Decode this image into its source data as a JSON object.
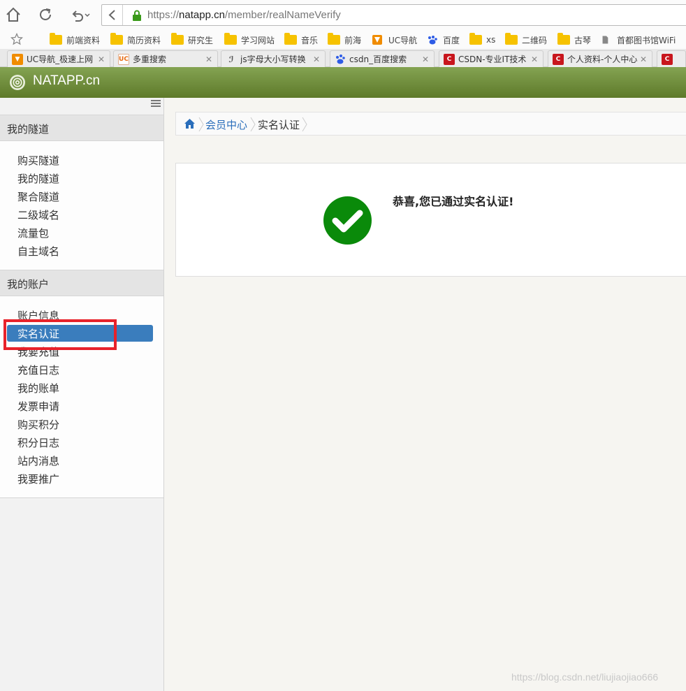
{
  "browser": {
    "url_prefix": "https://",
    "url_domain": "natapp.cn",
    "url_path": "/member/realNameVerify",
    "bookmarks": [
      {
        "label": "前端资料",
        "icon": "folder-icon"
      },
      {
        "label": "简历资料",
        "icon": "folder-icon"
      },
      {
        "label": "研究生",
        "icon": "folder-icon"
      },
      {
        "label": "学习网站",
        "icon": "folder-icon"
      },
      {
        "label": "音乐",
        "icon": "folder-icon"
      },
      {
        "label": "前海",
        "icon": "folder-icon"
      },
      {
        "label": "UC导航",
        "icon": "uc-nav-icon"
      },
      {
        "label": "百度",
        "icon": "baidu-icon"
      },
      {
        "label": "xs",
        "icon": "folder-icon"
      },
      {
        "label": "二维码",
        "icon": "folder-icon"
      },
      {
        "label": "古琴",
        "icon": "folder-icon"
      },
      {
        "label": "首都图书馆WiFi",
        "icon": "page-icon"
      }
    ],
    "tabs": [
      {
        "title": "UC导航_极速上网",
        "icon": "uc-nav-icon"
      },
      {
        "title": "多重搜索",
        "icon": "uc-icon"
      },
      {
        "title": "js字母大小写转换",
        "icon": "js-icon"
      },
      {
        "title": "csdn_百度搜索",
        "icon": "baidu-icon"
      },
      {
        "title": "CSDN-专业IT技术",
        "icon": "csdn-icon"
      },
      {
        "title": "个人资料-个人中心",
        "icon": "csdn-icon"
      },
      {
        "title": "",
        "icon": "csdn-icon"
      }
    ],
    "colors": {
      "csdn": "#c8161d",
      "uc": "#f08c00",
      "baidu": "#2e5ce6"
    }
  },
  "site": {
    "brand": "NATAPP.cn",
    "header_color": "#6e8c3a"
  },
  "sidebar": {
    "section1": {
      "title": "我的隧道",
      "items": [
        "购买隧道",
        "我的隧道",
        "聚合隧道",
        "二级域名",
        "流量包",
        "自主域名"
      ]
    },
    "section2": {
      "title": "我的账户",
      "items": [
        "账户信息",
        "实名认证",
        "我要充值",
        "充值日志",
        "我的账单",
        "发票申请",
        "购买积分",
        "积分日志",
        "站内消息",
        "我要推广"
      ],
      "active": "实名认证"
    },
    "active_color": "#3a7dbd"
  },
  "breadcrumb": {
    "parent": "会员中心",
    "current": "实名认证"
  },
  "result": {
    "message": "恭喜,您已通过实名认证!",
    "icon_color": "#0a8a0a"
  },
  "watermark": "https://blog.csdn.net/liujiaojiao666"
}
